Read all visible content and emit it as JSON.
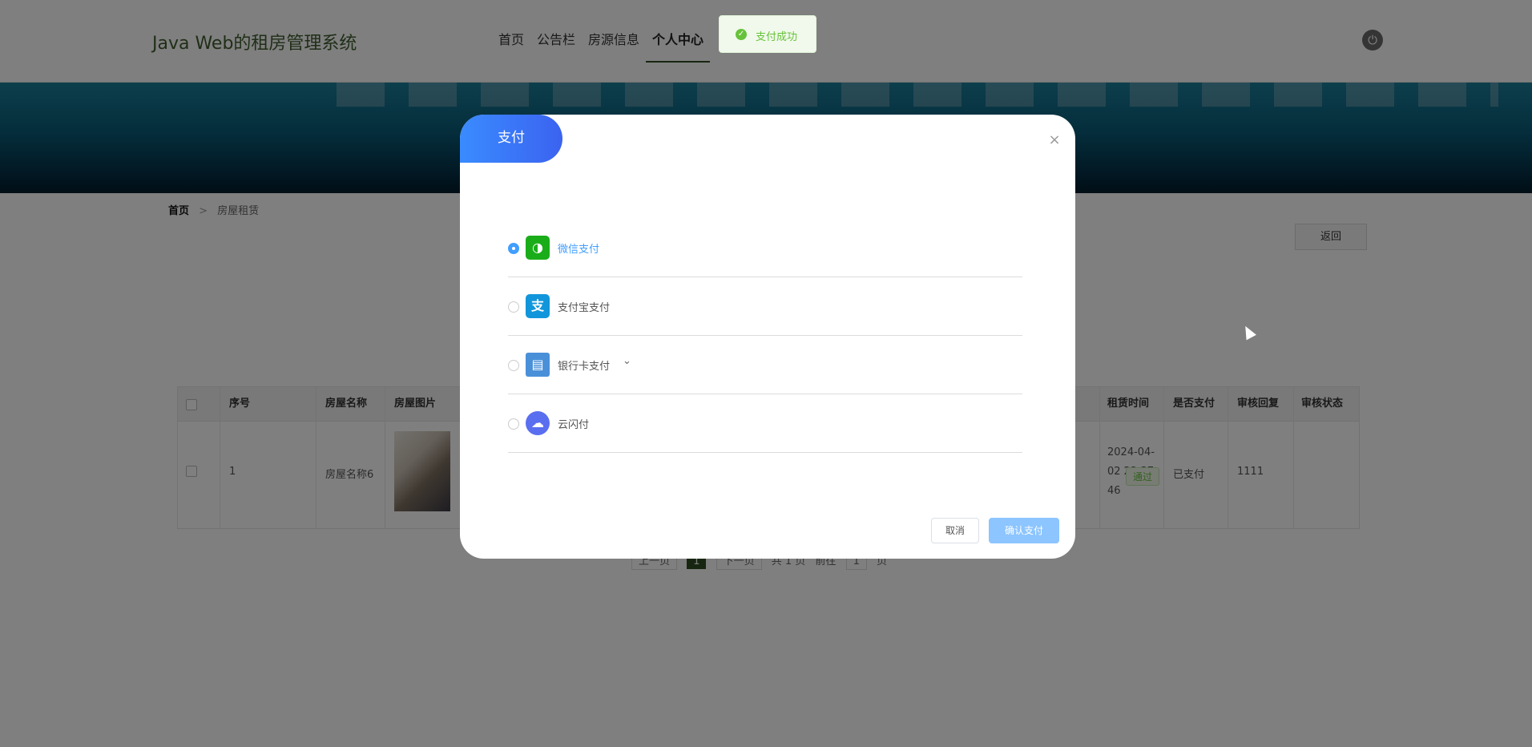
{
  "header": {
    "site_title": "Java Web的租房管理系统",
    "nav": [
      "首页",
      "公告栏",
      "房源信息",
      "个人中心"
    ],
    "active_nav": "个人中心",
    "power_icon": "power-icon"
  },
  "breadcrumb": {
    "home": "首页",
    "separator": ">",
    "current": "房屋租赁"
  },
  "back_button": "返回",
  "table": {
    "headers": [
      "序号",
      "房屋名称",
      "房屋图片",
      "租赁时间",
      "是否支付",
      "审核回复",
      "审核状态"
    ],
    "rows": [
      {
        "index": "1",
        "name": "房屋名称6",
        "time_line1": "2024-04-",
        "time_line2": "02 22:37:",
        "time_line3": "46",
        "paid": "已支付",
        "reply": "1111",
        "status": "通过"
      }
    ]
  },
  "pager": {
    "prev": "上一页",
    "current": "1",
    "next": "下一页",
    "total": "共 1 页",
    "goto": "前往",
    "page_input": "1",
    "page_unit": "页"
  },
  "toast": {
    "text": "支付成功",
    "icon": "check-circle-icon",
    "color": "#67c23a"
  },
  "dialog": {
    "title": "支付",
    "close_icon": "close-icon",
    "options": [
      {
        "label": "微信支付",
        "icon": "wechat-pay-icon",
        "color": "#1aad19",
        "selected": true
      },
      {
        "label": "支付宝支付",
        "icon": "alipay-icon",
        "color": "#1296db",
        "selected": false
      },
      {
        "label": "银行卡支付",
        "icon": "bank-card-icon",
        "color": "#4a90d9",
        "selected": false
      },
      {
        "label": "云闪付",
        "icon": "unionpay-cloud-icon",
        "color": "#5a6ef0",
        "selected": false
      }
    ],
    "cancel": "取消",
    "confirm": "确认支付"
  },
  "colors": {
    "accent": "#409eff",
    "brand_green": "#2e4d23",
    "title_gradient_start": "#3a8bff",
    "title_gradient_end": "#3b63f0"
  }
}
